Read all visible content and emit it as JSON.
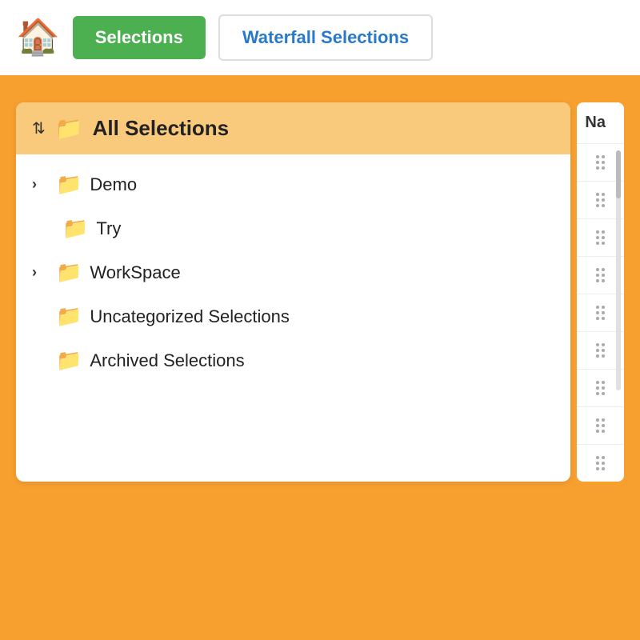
{
  "header": {
    "home_icon": "🏠",
    "selections_label": "Selections",
    "waterfall_label": "Waterfall Selections"
  },
  "sidebar": {
    "all_selections_label": "All Selections",
    "items": [
      {
        "label": "Demo",
        "has_chevron": true,
        "indented": false
      },
      {
        "label": "Try",
        "has_chevron": false,
        "indented": true
      },
      {
        "label": "WorkSpace",
        "has_chevron": true,
        "indented": false
      },
      {
        "label": "Uncategorized Selections",
        "has_chevron": false,
        "indented": false
      },
      {
        "label": "Archived Selections",
        "has_chevron": false,
        "indented": false
      }
    ]
  },
  "right_column": {
    "header": "Na",
    "rows": 9
  },
  "colors": {
    "background": "#F7A030",
    "header_bg": "#FFFFFF",
    "selections_btn_bg": "#4CAF50",
    "waterfall_btn_color": "#2979C8",
    "all_selections_bg": "#F9C97C",
    "home_icon_color": "#2979C8"
  }
}
